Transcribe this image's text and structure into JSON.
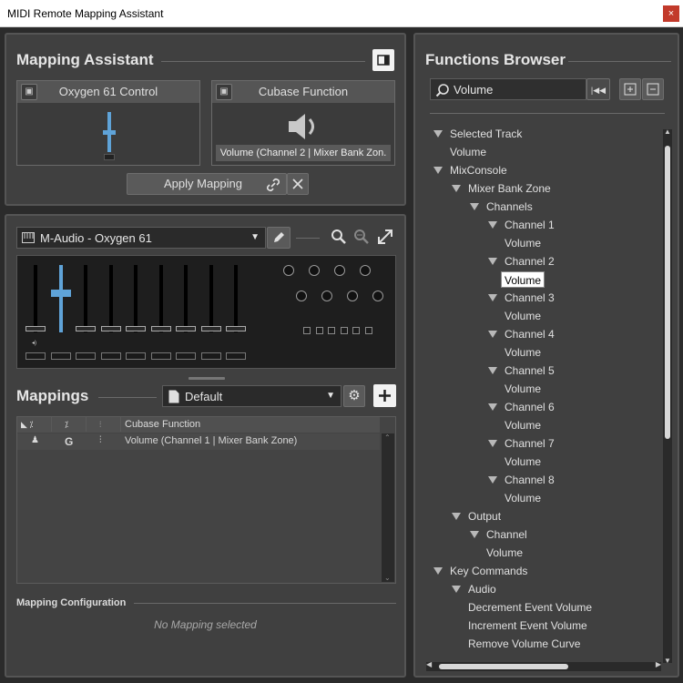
{
  "window": {
    "title": "MIDI Remote Mapping Assistant",
    "close_glyph": "×"
  },
  "mapping_assistant": {
    "title": "Mapping Assistant",
    "left_box": {
      "title": "Oxygen 61 Control"
    },
    "right_box": {
      "title": "Cubase Function",
      "value": "Volume (Channel 2 | Mixer Bank Zon."
    },
    "apply_label": "Apply Mapping",
    "fader_value": 0.55
  },
  "device": {
    "name": "M-Audio - Oxygen 61",
    "faders": [
      0.06,
      0.6,
      0.06,
      0.06,
      0.06,
      0.06,
      0.06,
      0.06,
      0.06
    ]
  },
  "mappings": {
    "title": "Mappings",
    "page_name": "Default",
    "columns": [
      "",
      "",
      "",
      "Cubase Function"
    ],
    "rows": [
      {
        "col1": "",
        "col2": "G",
        "col3": "",
        "function": "Volume (Channel 1 | Mixer Bank Zone)"
      }
    ],
    "config_title": "Mapping Configuration",
    "config_empty": "No Mapping selected"
  },
  "functions_browser": {
    "title": "Functions Browser",
    "search_value": "Volume",
    "tree": [
      {
        "label": "Selected Track",
        "level": 0,
        "expandable": true
      },
      {
        "label": "Volume",
        "level": 1,
        "expandable": false
      },
      {
        "label": "MixConsole",
        "level": 0,
        "expandable": true
      },
      {
        "label": "Mixer Bank Zone",
        "level": 1,
        "expandable": true
      },
      {
        "label": "Channels",
        "level": 2,
        "expandable": true
      },
      {
        "label": "Channel 1",
        "level": 3,
        "expandable": true
      },
      {
        "label": "Volume",
        "level": 4,
        "expandable": false
      },
      {
        "label": "Channel 2",
        "level": 3,
        "expandable": true
      },
      {
        "label": "Volume",
        "level": 4,
        "expandable": false,
        "selected": true
      },
      {
        "label": "Channel 3",
        "level": 3,
        "expandable": true
      },
      {
        "label": "Volume",
        "level": 4,
        "expandable": false
      },
      {
        "label": "Channel 4",
        "level": 3,
        "expandable": true
      },
      {
        "label": "Volume",
        "level": 4,
        "expandable": false
      },
      {
        "label": "Channel 5",
        "level": 3,
        "expandable": true
      },
      {
        "label": "Volume",
        "level": 4,
        "expandable": false
      },
      {
        "label": "Channel 6",
        "level": 3,
        "expandable": true
      },
      {
        "label": "Volume",
        "level": 4,
        "expandable": false
      },
      {
        "label": "Channel 7",
        "level": 3,
        "expandable": true
      },
      {
        "label": "Volume",
        "level": 4,
        "expandable": false
      },
      {
        "label": "Channel 8",
        "level": 3,
        "expandable": true
      },
      {
        "label": "Volume",
        "level": 4,
        "expandable": false
      },
      {
        "label": "Output",
        "level": 1,
        "expandable": true
      },
      {
        "label": "Channel",
        "level": 2,
        "expandable": true
      },
      {
        "label": "Volume",
        "level": 3,
        "expandable": false
      },
      {
        "label": "Key Commands",
        "level": 0,
        "expandable": true
      },
      {
        "label": "Audio",
        "level": 1,
        "expandable": true
      },
      {
        "label": "Decrement Event Volume",
        "level": 2,
        "expandable": false
      },
      {
        "label": "Increment Event Volume",
        "level": 2,
        "expandable": false
      },
      {
        "label": "Remove Volume Curve",
        "level": 2,
        "expandable": false
      }
    ]
  },
  "colors": {
    "accent": "#5fa3d8",
    "selected_bg": "#ffffff",
    "selected_text": "#000000"
  }
}
